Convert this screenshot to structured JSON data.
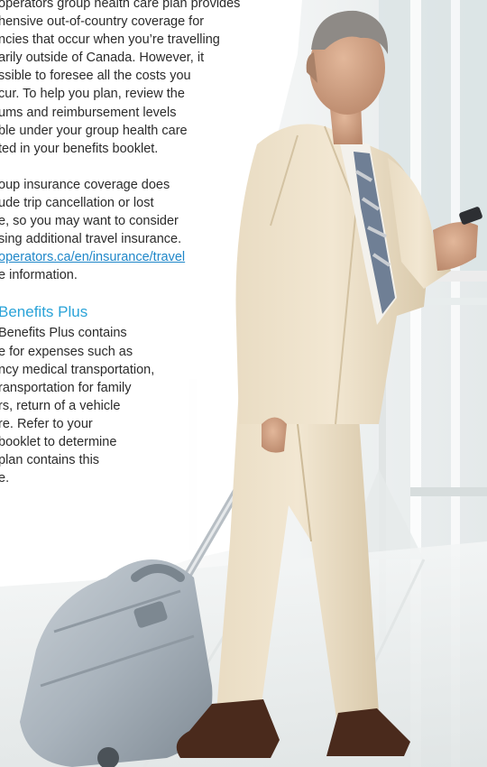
{
  "body": {
    "para1": [
      "operators group health care plan provides",
      "hensive out-of-country coverage for",
      "ncies that occur when you’re travelling",
      "arily outside of Canada. However, it",
      "ssible to foresee all the costs you",
      "cur. To help you plan, review the",
      "ums and reimbursement levels",
      "ble under your group health care",
      "ted in your benefits booklet."
    ],
    "para2": {
      "lines": [
        "oup insurance coverage does",
        "ude trip cancellation or lost",
        "e, so you may want to consider",
        "sing additional travel insurance."
      ],
      "link_text": "operators.ca/en/insurance/travel",
      "after_link": "e information."
    },
    "section": {
      "heading": "Benefits Plus",
      "lines": [
        "Benefits Plus contains",
        "e for expenses such as",
        "ncy medical transportation,",
        "ransportation for family",
        "rs, return of a vehicle",
        "re. Refer to your",
        "booklet to determine",
        "plan contains this",
        "e."
      ]
    }
  },
  "colors": {
    "heading": "#2aa3d8",
    "link": "#1f87c9",
    "body_text": "#2b2b2b"
  }
}
